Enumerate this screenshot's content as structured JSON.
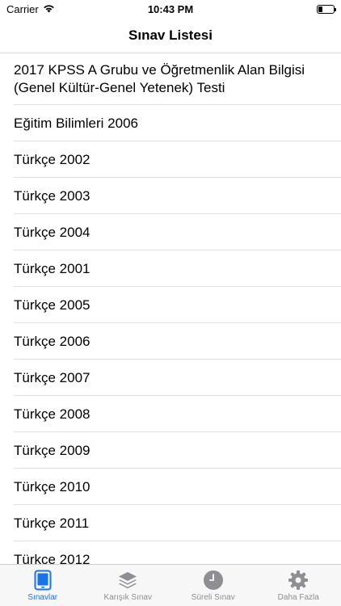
{
  "status_bar": {
    "carrier": "Carrier",
    "time": "10:43 PM"
  },
  "nav": {
    "title": "Sınav Listesi"
  },
  "list": {
    "items": [
      {
        "label": "2017 KPSS A Grubu ve Öğretmenlik Alan Bilgisi (Genel Kültür-Genel Yetenek) Testi"
      },
      {
        "label": "Eğitim Bilimleri 2006"
      },
      {
        "label": "Türkçe 2002"
      },
      {
        "label": "Türkçe 2003"
      },
      {
        "label": "Türkçe 2004"
      },
      {
        "label": "Türkçe 2001"
      },
      {
        "label": "Türkçe 2005"
      },
      {
        "label": "Türkçe 2006"
      },
      {
        "label": "Türkçe 2007"
      },
      {
        "label": "Türkçe 2008"
      },
      {
        "label": "Türkçe 2009"
      },
      {
        "label": "Türkçe 2010"
      },
      {
        "label": "Türkçe 2011"
      },
      {
        "label": "Türkçe 2012"
      }
    ]
  },
  "tab_bar": {
    "tabs": [
      {
        "label": "Sınavlar",
        "icon": "tablet-icon",
        "active": true
      },
      {
        "label": "Karışık Sınav",
        "icon": "stack-icon",
        "active": false
      },
      {
        "label": "Süreli Sınav",
        "icon": "clock-icon",
        "active": false
      },
      {
        "label": "Daha Fazla",
        "icon": "gear-icon",
        "active": false
      }
    ]
  },
  "colors": {
    "accent": "#1a73e8",
    "inactive": "#8e8e93",
    "separator": "#e0e0e0"
  }
}
